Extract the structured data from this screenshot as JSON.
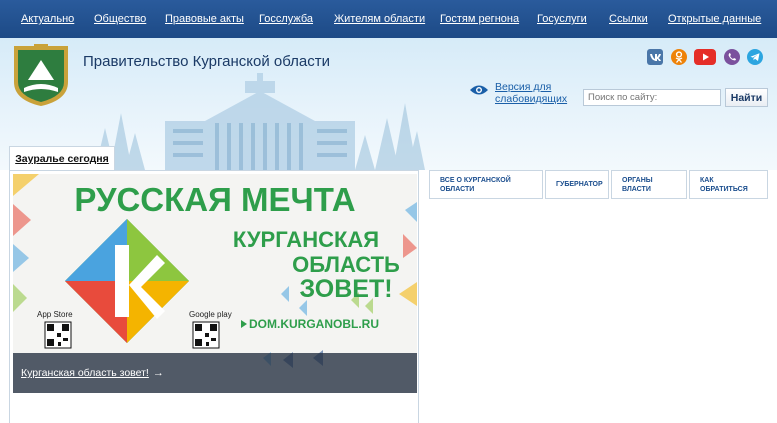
{
  "topnav": {
    "items": [
      "Актуально",
      "Общество",
      "Правовые акты",
      "Госслужба",
      "Жителям области",
      "Гостям регнона",
      "Госуслуги",
      "Ссылки",
      "Открытые данные"
    ]
  },
  "header": {
    "title": "Правительство Курганской области",
    "vision_label": "Версия для слабовидящих",
    "search": {
      "placeholder": "Поиск по сайту:",
      "value": "",
      "button": "Найти"
    },
    "social_icons": [
      "vk-icon",
      "odnoklassniki-icon",
      "youtube-icon",
      "viber-icon",
      "telegram-icon"
    ],
    "colors": {
      "nav": "#1d4a86",
      "accent": "#1a5fa8",
      "vk": "#4a76a8",
      "ok": "#ee8208",
      "youtube": "#e52d27",
      "viber": "#7b519d",
      "telegram": "#2ca5e0"
    }
  },
  "tab": {
    "label": "Зауралье сегодня"
  },
  "banner": {
    "headline": "РУССКАЯ МЕЧТА",
    "line1": "КУРГАНСКАЯ",
    "line2": "ОБЛАСТЬ",
    "line3": "ЗОВЕТ!",
    "url": "DOM.KURGANOBL.RU",
    "app_store": "App Store",
    "google_play": "Google play",
    "caption_link": "Курганская область зовет!",
    "caption_arrow": "→"
  },
  "quick_links": [
    "ВСЕ О КУРГАНСКОЙ ОБЛАСТИ",
    "ГУБЕРНАТОР",
    "ОРГАНЫ ВЛАСТИ",
    "КАК ОБРАТИТЬСЯ"
  ]
}
